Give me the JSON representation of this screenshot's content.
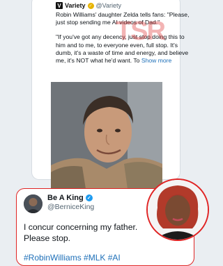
{
  "quote": {
    "account_name": "Variety",
    "handle": "@Variety",
    "logo_letter": "V",
    "paragraph1": "Robin Williams' daughter Zelda tells fans: \"Please, just stop sending me AI videos of Dad.\"",
    "paragraph2": "\"If you've got any decency, just stop doing this to him and to me, to everyone even, full stop. It's dumb, it's a waste of time and energy, and believe me, it's NOT what he'd want. To",
    "show_more": "Show more",
    "watermark": "TSR"
  },
  "tweet": {
    "name": "Be A King",
    "handle": "@BerniceKing",
    "line1": "I concur concerning my father.",
    "line2": "Please stop.",
    "hashtags": "#RobinWilliams #MLK #AI"
  },
  "colors": {
    "accent_red": "#e02424",
    "link_blue": "#1d6fb8",
    "verified_gold": "#e7b400",
    "verified_blue": "#1d9bf0"
  }
}
